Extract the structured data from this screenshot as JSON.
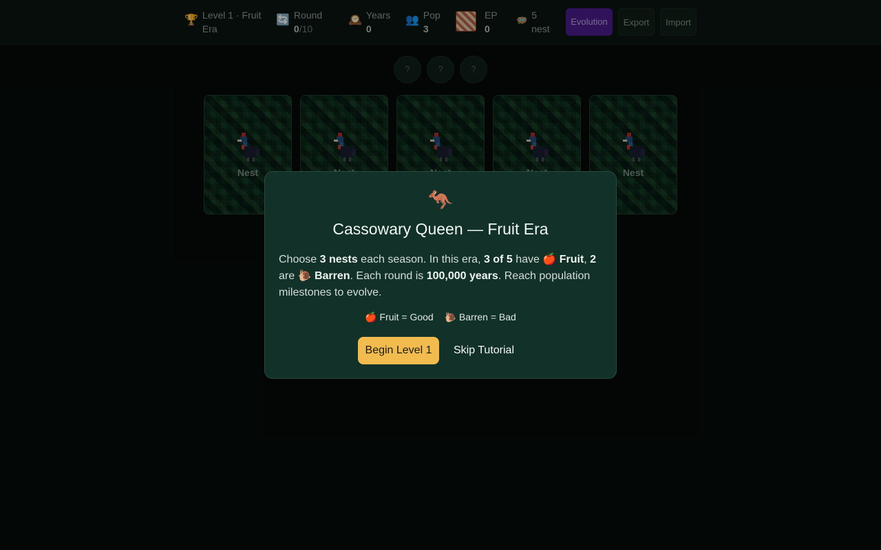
{
  "header": {
    "level": {
      "icon": "trophy-icon",
      "label": "Level 1 · Fruit Era"
    },
    "round": {
      "icon": "cycle-icon",
      "label": "Round",
      "value": "0",
      "total": "/10"
    },
    "years": {
      "icon": "clock-icon",
      "label": "Years",
      "value": "0"
    },
    "pop": {
      "icon": "people-icon",
      "label": "Pop",
      "value": "3"
    },
    "ep": {
      "icon": "dna-icon",
      "label": "EP",
      "value": "0"
    },
    "nest": {
      "icon": "nest-icon",
      "value": "5",
      "label": "nest"
    },
    "buttons": {
      "evolution": "Evolution",
      "export": "Export",
      "import": "Import"
    }
  },
  "slots": [
    "?",
    "?",
    "?"
  ],
  "cards": [
    {
      "label": "Nest"
    },
    {
      "label": "Nest"
    },
    {
      "label": "Nest"
    },
    {
      "label": "Nest"
    },
    {
      "label": "Nest"
    }
  ],
  "modal": {
    "icon": "🦘",
    "title": "Cassowary Queen — Fruit Era",
    "body": {
      "t1": "Choose ",
      "b1": "3 nests",
      "t2": " each season. In this era, ",
      "b2": "3 of 5",
      "t3": " have ",
      "e1": "🍎",
      "b3": "Fruit",
      "t4": ", ",
      "b4": "2",
      "t5": " are ",
      "e2": "🐌",
      "b5": "Barren",
      "t6": ". Each round is ",
      "b6": "100,000 years",
      "t7": ". Reach population milestones to evolve."
    },
    "legend": {
      "good": "🍎 Fruit = Good",
      "bad": "🐌 Barren = Bad"
    },
    "begin": "Begin Level 1",
    "skip": "Skip Tutorial"
  },
  "colors": {
    "accent": "#f2bb4e",
    "evolution": "#4a1d8a",
    "modal_bg": "#123128"
  }
}
